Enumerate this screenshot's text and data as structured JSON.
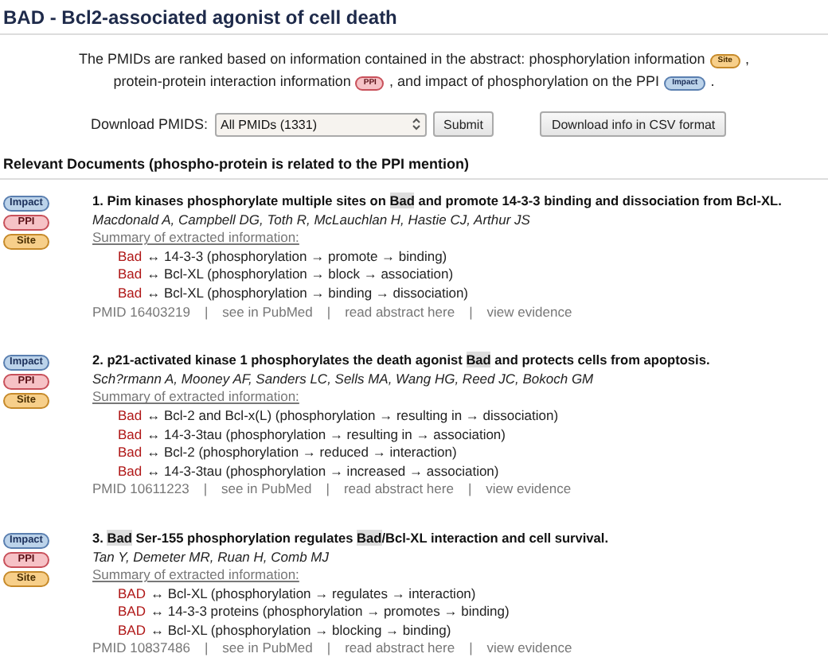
{
  "title": "BAD - Bcl2-associated agonist of cell death",
  "intro": [
    {
      "kind": "text",
      "text": "The PMIDs are ranked based on information contained in the abstract: phosphorylation information"
    },
    {
      "kind": "site",
      "text": "Site"
    },
    {
      "kind": "text",
      "text": ", protein-protein interaction information"
    },
    {
      "kind": "ppi",
      "text": "PPI"
    },
    {
      "kind": "text",
      "text": ", and impact of phosphorylation on the PPI"
    },
    {
      "kind": "impact",
      "text": "Impact"
    },
    {
      "kind": "text",
      "text": "."
    }
  ],
  "download": {
    "label": "Download PMIDS:",
    "select": "All PMIDs (1331)",
    "submit": "Submit",
    "csv": "Download info in CSV format"
  },
  "section_heading": "Relevant Documents (phospho-protein is related to the PPI mention)",
  "documents": [
    {
      "badges": [
        {
          "kind": "impact",
          "text": "Impact"
        },
        {
          "kind": "ppi",
          "text": "PPI"
        },
        {
          "kind": "site",
          "text": "Site"
        }
      ],
      "title": [
        {
          "text": "1. Pim kinases phosphorylate multiple sites on ",
          "highlight": false
        },
        {
          "text": "Bad",
          "highlight": true
        },
        {
          "text": " and promote 14-3-3 binding and dissociation from Bcl-XL.",
          "highlight": false
        }
      ],
      "authors": "Macdonald A, Campbell DG, Toth R, McLauchlan H, Hastie CJ, Arthur JS",
      "summary_label": "Summary of extracted information:",
      "facts": [
        {
          "protein": "Bad",
          "text": "↔ 14-3-3 (phosphorylation → promote → binding)"
        },
        {
          "protein": "Bad",
          "text": "↔ Bcl-XL (phosphorylation → block → association)"
        },
        {
          "protein": "Bad",
          "text": "↔ Bcl-XL (phosphorylation → binding → dissociation)"
        }
      ],
      "links": [
        "PMID 16403219",
        "see in PubMed",
        "read abstract here",
        "view evidence"
      ],
      "separator": "|"
    },
    {
      "badges": [
        {
          "kind": "impact",
          "text": "Impact"
        },
        {
          "kind": "ppi",
          "text": "PPI"
        },
        {
          "kind": "site",
          "text": "Site"
        }
      ],
      "title": [
        {
          "text": "2. p21-activated kinase 1 phosphorylates the death agonist ",
          "highlight": false
        },
        {
          "text": "Bad",
          "highlight": true
        },
        {
          "text": " and protects cells from apoptosis.",
          "highlight": false
        }
      ],
      "authors": "Sch?rmann A, Mooney AF, Sanders LC, Sells MA, Wang HG, Reed JC, Bokoch GM",
      "summary_label": "Summary of extracted information:",
      "facts": [
        {
          "protein": "Bad",
          "text": "↔ Bcl-2 and Bcl-x(L) (phosphorylation → resulting in → dissociation)"
        },
        {
          "protein": "Bad",
          "text": "↔ 14-3-3tau (phosphorylation → resulting in → association)"
        },
        {
          "protein": "Bad",
          "text": "↔ Bcl-2 (phosphorylation → reduced → interaction)"
        },
        {
          "protein": "Bad",
          "text": "↔ 14-3-3tau (phosphorylation → increased → association)"
        }
      ],
      "links": [
        "PMID 10611223",
        "see in PubMed",
        "read abstract here",
        "view evidence"
      ],
      "separator": "|"
    },
    {
      "badges": [
        {
          "kind": "impact",
          "text": "Impact"
        },
        {
          "kind": "ppi",
          "text": "PPI"
        },
        {
          "kind": "site",
          "text": "Site"
        }
      ],
      "title": [
        {
          "text": "3. ",
          "highlight": false
        },
        {
          "text": "Bad",
          "highlight": true
        },
        {
          "text": " Ser-155 phosphorylation regulates ",
          "highlight": false
        },
        {
          "text": "Bad",
          "highlight": true
        },
        {
          "text": "/Bcl-XL interaction and cell survival.",
          "highlight": false
        }
      ],
      "authors": "Tan Y, Demeter MR, Ruan H, Comb MJ",
      "summary_label": "Summary of extracted information:",
      "facts": [
        {
          "protein": "BAD",
          "text": "↔ Bcl-XL (phosphorylation → regulates → interaction)"
        },
        {
          "protein": "BAD",
          "text": "↔ 14-3-3 proteins (phosphorylation → promotes → binding)"
        },
        {
          "protein": "BAD",
          "text": "↔ Bcl-XL (phosphorylation → blocking → binding)"
        }
      ],
      "links": [
        "PMID 10837486",
        "see in PubMed",
        "read abstract here",
        "view evidence"
      ],
      "separator": "|"
    }
  ]
}
